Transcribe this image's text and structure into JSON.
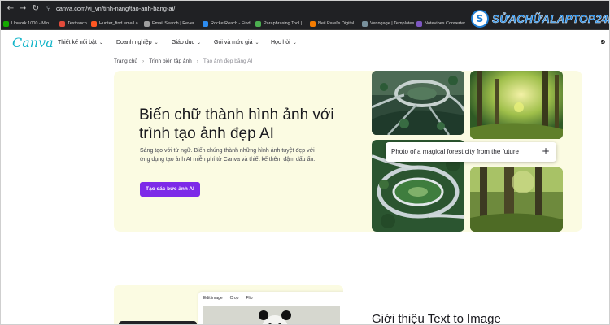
{
  "browser": {
    "url": "canva.com/vi_vn/tinh-nang/tao-anh-bang-ai/",
    "bookmarks": [
      {
        "label": "Upwork 1000 - Min...",
        "color": "#14a800"
      },
      {
        "label": "Textranch",
        "color": "#e24b3b"
      },
      {
        "label": "Hunter_find email a...",
        "color": "#ff5722"
      },
      {
        "label": "Email Search | Rever...",
        "color": "#9e9e9e"
      },
      {
        "label": "RocketReach - Find...",
        "color": "#2d8cf0"
      },
      {
        "label": "Paraphrasing Tool |...",
        "color": "#4caf50"
      },
      {
        "label": "Neil Patel's Digital...",
        "color": "#f57c00"
      },
      {
        "label": "Venngage | Templates",
        "color": "#78909c"
      },
      {
        "label": "Notevibes Converter",
        "color": "#7e57c2"
      }
    ]
  },
  "watermark": {
    "badge": "S",
    "text": "SỬACHỮALAPTOP24h.com"
  },
  "canva": {
    "logo": "Canva",
    "nav": [
      {
        "label": "Thiết kế nổi bật"
      },
      {
        "label": "Doanh nghiệp"
      },
      {
        "label": "Giáo dục"
      },
      {
        "label": "Gói và mức giá"
      },
      {
        "label": "Học hỏi"
      }
    ],
    "nav_right": "Đ",
    "breadcrumb": [
      "Trang chủ",
      "Trình biên tập ảnh",
      "Tạo ảnh đẹp bằng AI"
    ],
    "hero": {
      "title": "Biến chữ thành hình ảnh với trình tạo ảnh đẹp AI",
      "description": "Sáng tạo với từ ngữ. Biến chúng thành những hình ảnh tuyệt đẹp với ứng dụng tạo ảnh AI miễn phí từ Canva và thiết kế thêm đậm dấu ấn.",
      "cta": "Tạo các bức ảnh AI",
      "prompt": "Photo of a magical forest city from the future",
      "accent": "#7d2ae8",
      "background": "#fbfbe2"
    },
    "editor_tabs": [
      "Edit image",
      "Crop",
      "Flip"
    ],
    "section_title": "Giới thiệu Text to Image"
  }
}
